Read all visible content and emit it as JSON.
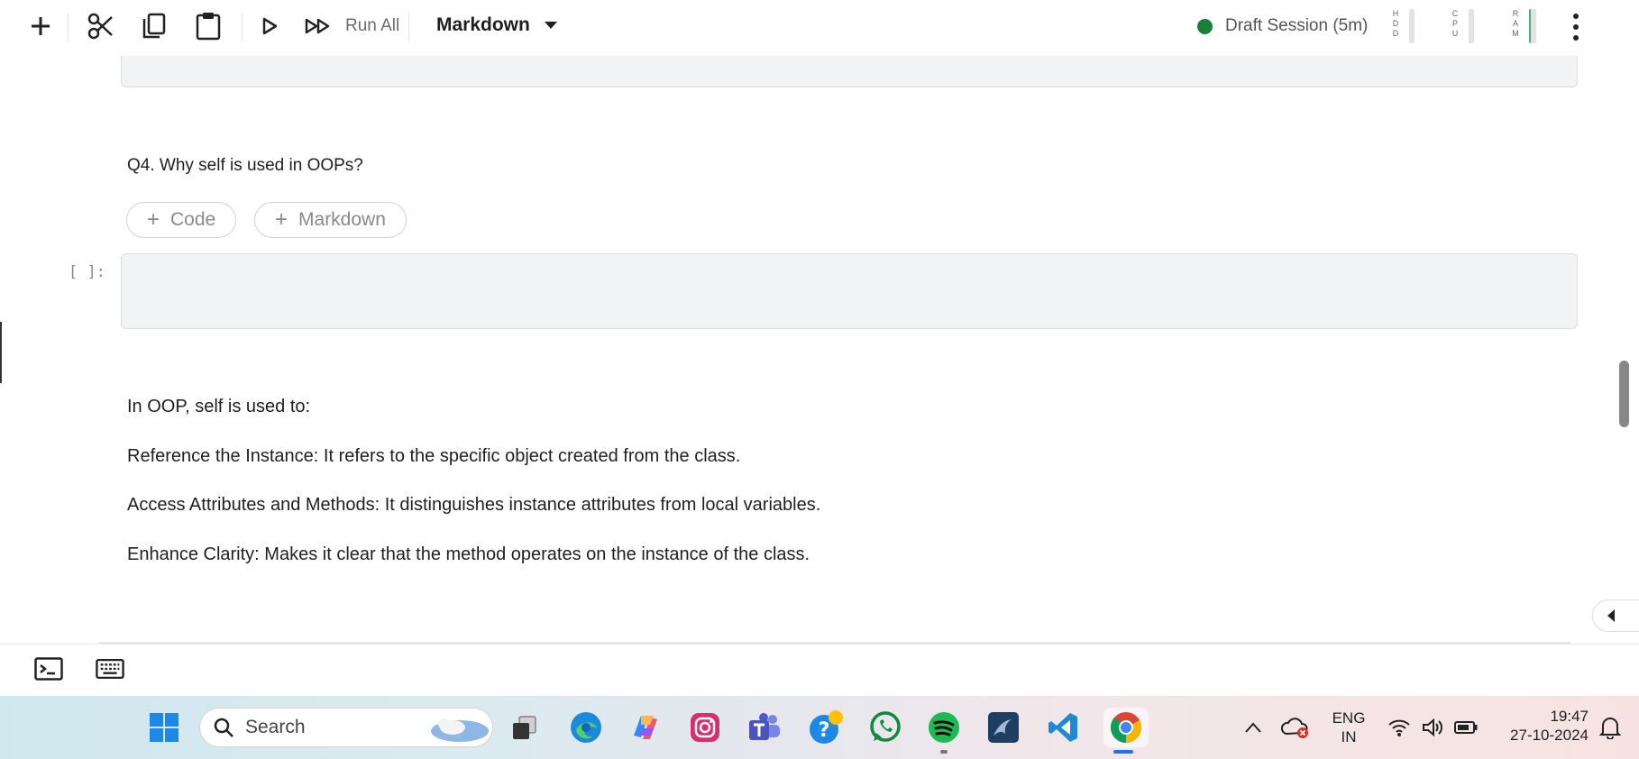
{
  "toolbar": {
    "run_all_label": "Run All",
    "cell_type": "Markdown",
    "session_label": "Draft Session (5m)",
    "session_color": "#1a7f37",
    "meters": [
      "HDD",
      "CPU",
      "RAM"
    ],
    "icons": [
      "add-icon",
      "cut-icon",
      "copy-icon",
      "paste-icon",
      "run-icon",
      "run-all-icon",
      "more-icon"
    ]
  },
  "notebook": {
    "question": "Q4. Why self is used in OOPs?",
    "add_code_label": "Code",
    "add_markdown_label": "Markdown",
    "prompt": "[ ]:",
    "answer_lines": [
      "In OOP, self is used to:",
      "Reference the Instance: It refers to the specific object created from the class.",
      "Access Attributes and Methods: It distinguishes instance attributes from local variables.",
      "Enhance Clarity: Makes it clear that the method operates on the instance of the class."
    ]
  },
  "statusbar": {
    "icons": [
      "terminal-icon",
      "keyboard-icon"
    ]
  },
  "taskbar": {
    "search_placeholder": "Search",
    "apps": [
      "windows-start-icon",
      "task-view-icon",
      "edge-icon",
      "copilot-icon",
      "instagram-icon",
      "teams-icon",
      "help-icon",
      "whatsapp-icon",
      "spotify-icon",
      "mysql-icon",
      "vscode-icon",
      "chrome-icon"
    ],
    "language_line1": "ENG",
    "language_line2": "IN",
    "time": "19:47",
    "date": "27-10-2024"
  }
}
